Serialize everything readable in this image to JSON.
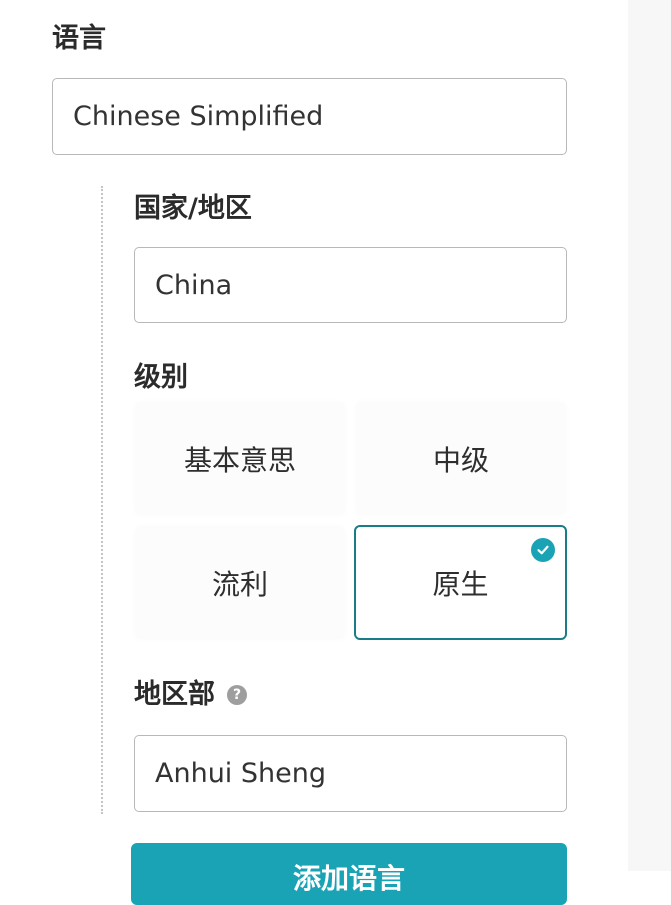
{
  "language": {
    "label": "语言",
    "value": "Chinese Simplified"
  },
  "country": {
    "label": "国家/地区",
    "value": "China"
  },
  "level": {
    "label": "级别",
    "options": [
      "基本意思",
      "中级",
      "流利",
      "原生"
    ],
    "selected": "原生"
  },
  "region": {
    "label": "地区部",
    "help_icon": "?",
    "value": "Anhui Sheng"
  },
  "submit": {
    "label": "添加语言"
  },
  "colors": {
    "accent": "#1aa3b5",
    "selected_border": "#1a7c86"
  }
}
